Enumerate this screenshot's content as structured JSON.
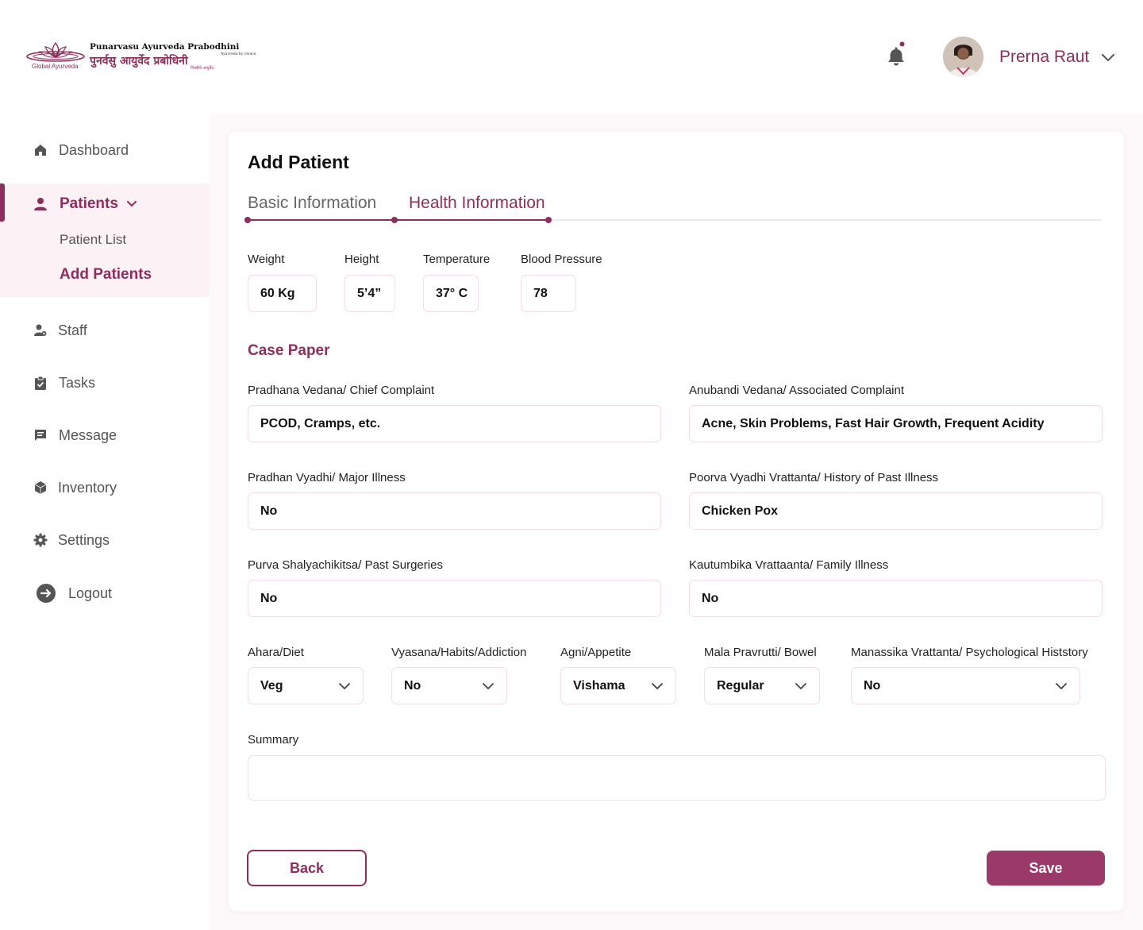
{
  "brand": {
    "name_en": "Punarvasu Ayurveda Prabodhini",
    "tagline_en": "Ayurveda by choice",
    "name_hi": "पुनर्वसु आयुर्वेद प्रबोधिनी",
    "tagline_hi": "निवडीचे आयुर्वेद",
    "sub": "Global Ayurveda"
  },
  "header": {
    "user_name": "Prerna Raut",
    "notification_dot": true
  },
  "sidebar": {
    "items": [
      {
        "label": "Dashboard",
        "icon": "home-icon"
      },
      {
        "label": "Patients",
        "icon": "person-icon"
      },
      {
        "label": "Staff",
        "icon": "staff-icon"
      },
      {
        "label": "Tasks",
        "icon": "clipboard-icon"
      },
      {
        "label": "Message",
        "icon": "message-icon"
      },
      {
        "label": "Inventory",
        "icon": "box-icon"
      },
      {
        "label": "Settings",
        "icon": "gear-icon"
      },
      {
        "label": "Logout",
        "icon": "logout-icon"
      }
    ],
    "patients_sub": [
      "Patient List",
      "Add Patients"
    ],
    "active_sub": "Add Patients"
  },
  "page": {
    "title": "Add Patient",
    "tabs": [
      "Basic Information",
      "Health Information"
    ],
    "active_tab": "Health Information"
  },
  "vitals": {
    "weight": {
      "label": "Weight",
      "value": "60 Kg"
    },
    "height": {
      "label": "Height",
      "value": "5’4”"
    },
    "temperature": {
      "label": "Temperature",
      "value": "37° C"
    },
    "blood_pressure": {
      "label": "Blood Pressure",
      "value": "78"
    }
  },
  "case_paper": {
    "title": "Case Paper",
    "chief_complaint": {
      "label": "Pradhana Vedana/ Chief Complaint",
      "value": "PCOD, Cramps, etc."
    },
    "associated_complaint": {
      "label": "Anubandi Vedana/ Associated Complaint",
      "value": "Acne, Skin Problems, Fast Hair Growth, Frequent Acidity"
    },
    "major_illness": {
      "label": "Pradhan Vyadhi/ Major Illness",
      "value": "No"
    },
    "past_illness": {
      "label": "Poorva Vyadhi Vrattanta/ History of Past Illness",
      "value": "Chicken Pox"
    },
    "past_surgeries": {
      "label": "Purva Shalyachikitsa/ Past Surgeries",
      "value": "No"
    },
    "family_illness": {
      "label": "Kautumbika Vrattaanta/ Family Illness",
      "value": "No"
    },
    "diet": {
      "label": "Ahara/Diet",
      "value": "Veg"
    },
    "habits": {
      "label": "Vyasana/Habits/Addiction",
      "value": "No"
    },
    "appetite": {
      "label": "Agni/Appetite",
      "value": "Vishama"
    },
    "bowel": {
      "label": "Mala Pravrutti/ Bowel",
      "value": "Regular"
    },
    "psychological": {
      "label": "Manassika Vrattanta/ Psychological Histstory",
      "value": "No"
    },
    "summary": {
      "label": "Summary",
      "value": ""
    }
  },
  "actions": {
    "back": "Back",
    "save": "Save"
  },
  "colors": {
    "accent": "#8e2e5c",
    "save_bg": "#9b3a69",
    "sidebar_active_bg": "#fcf1f5",
    "page_bg": "#fdf8fa"
  }
}
